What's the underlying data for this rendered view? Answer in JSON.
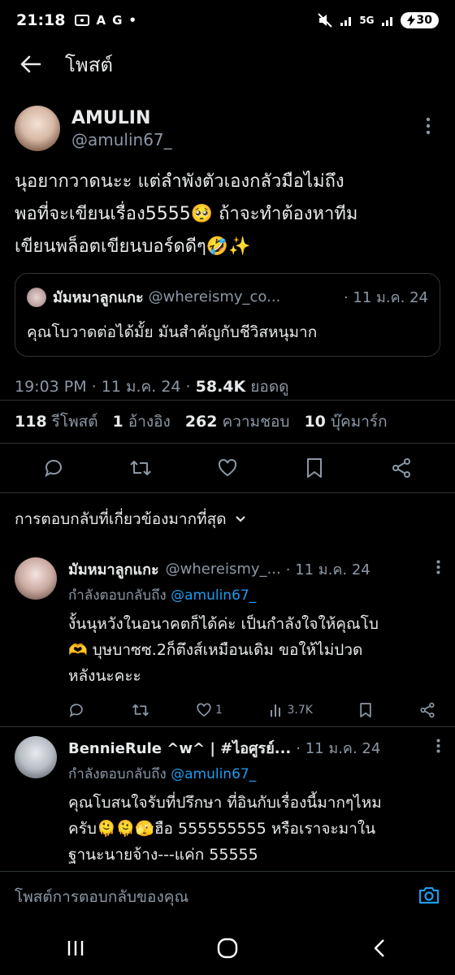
{
  "status": {
    "time": "21:18",
    "left_glyphs": [
      "A",
      "G"
    ],
    "network": "5G",
    "battery": "30"
  },
  "header": {
    "title": "โพสต์"
  },
  "post": {
    "author_name": "AMULIN",
    "author_handle": "@amulin67_",
    "text_lines": [
      "นุอยากวาดนะะ แต่ลำพังตัวเองกลัวมือไม่ถึง",
      "พอที่จะเขียนเรื่อง5555🥺 ถ้าจะทำต้องหาทีม",
      "เขียนพล็อตเขียนบอร์ดดีๆ🤣✨"
    ],
    "quote": {
      "name": "มัมหมาลูกแกะ",
      "handle": "@whereismy_co...",
      "date": "· 11 ม.ค. 24",
      "text": "คุณโบวาดต่อได้มั้ย มันสำคัญกับชีวิสหนุมาก"
    },
    "time": "19:03 PM · 11 ม.ค. 24 · ",
    "views": "58.4K",
    "views_label": " ยอดดู"
  },
  "stats": {
    "reposts": "118",
    "reposts_label": "รีโพสต์",
    "quotes": "1",
    "quotes_label": "อ้างอิง",
    "likes": "262",
    "likes_label": "ความชอบ",
    "bookmarks": "10",
    "bookmarks_label": "บุ๊คมาร์ก"
  },
  "sort_label": "การตอบกลับที่เกี่ยวข้องมากที่สุด",
  "replies": [
    {
      "name": "มัมหมาลูกแกะ",
      "handle": "@whereismy_...",
      "date": "· 11 ม.ค. 24",
      "reply_to_prefix": "กำลังตอบกลับถึง ",
      "reply_to_handle": "@amulin67_",
      "text_lines": [
        "งั้นนุหวังในอนาคตก็ได้ค่ะ เป็นกำลังใจให้คุณโบ",
        "🫶 บุษบาซซ.2ก็ตึงส์เหมือนเดิม ขอให้ไม่ปวด",
        "หลังนะคะะ"
      ],
      "likes": "1",
      "views": "3.7K"
    },
    {
      "name": "BennieRule ^w^ | #ไอศูรย์...",
      "handle": "",
      "date": "· 11 ม.ค. 24",
      "reply_to_prefix": "กำลังตอบกลับถึง ",
      "reply_to_handle": "@amulin67_",
      "text_lines": [
        "คุณโบสนใจรับที่ปรึกษา ที่อินกับเรื่องนี้มากๆไหม",
        "ครับ🫠🫠🫣ฮือ 555555555 หรือเราจะมาใน",
        "ฐานะนายจ้าง---แค่ก 55555"
      ]
    }
  ],
  "compose": {
    "placeholder": "โพสต์การตอบกลับของคุณ"
  },
  "colors": {
    "accent": "#1d9bf0",
    "background": "#000000",
    "muted": "#8b98a5"
  }
}
